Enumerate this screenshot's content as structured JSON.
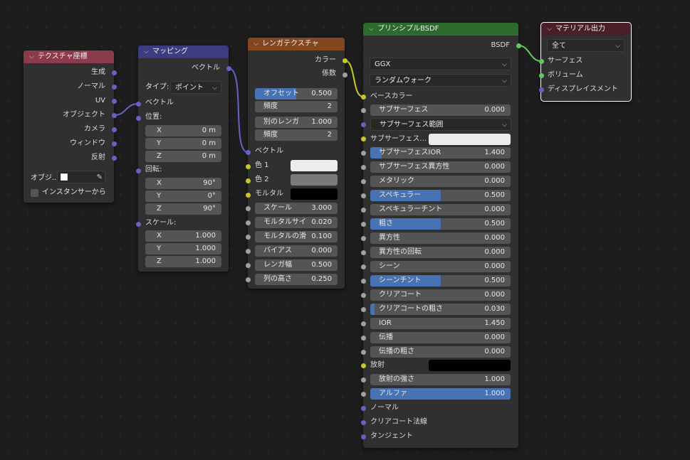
{
  "colors": {
    "header_texcoord": "#8c3a4e",
    "header_mapping": "#3c3c83",
    "header_brick": "#83461f",
    "header_principled": "#2c6b2e",
    "header_output": "#4a1f2a",
    "socket_vector": "#6363c7",
    "socket_color": "#c7c729",
    "socket_float": "#a1a1a1",
    "socket_shader": "#63c763",
    "slider_fill": "#4772b3"
  },
  "texcoord": {
    "title": "テクスチャ座標",
    "outputs": [
      "生成",
      "ノーマル",
      "UV",
      "オブジェクト",
      "カメラ",
      "ウィンドウ",
      "反射"
    ],
    "object_label": "オブジ...",
    "object_icon": "object-cube-icon",
    "eyedropper_icon": "eyedropper-icon",
    "instancer_label": "インスタンサーから",
    "instancer_checked": false
  },
  "mapping": {
    "title": "マッピング",
    "output_vector": "ベクトル",
    "type_label": "タイプ:",
    "type_value": "ポイント",
    "input_vector": "ベクトル",
    "location_label": "位置:",
    "location": [
      {
        "axis": "X",
        "value": "0 m"
      },
      {
        "axis": "Y",
        "value": "0 m"
      },
      {
        "axis": "Z",
        "value": "0 m"
      }
    ],
    "rotation_label": "回転:",
    "rotation": [
      {
        "axis": "X",
        "value": "90°"
      },
      {
        "axis": "Y",
        "value": "0°"
      },
      {
        "axis": "Z",
        "value": "90°"
      }
    ],
    "scale_label": "スケール:",
    "scale": [
      {
        "axis": "X",
        "value": "1.000"
      },
      {
        "axis": "Y",
        "value": "1.000"
      },
      {
        "axis": "Z",
        "value": "1.000"
      }
    ]
  },
  "brick": {
    "title": "レンガテクスチャ",
    "out_color": "カラー",
    "out_fac": "係数",
    "offset_label": "オフセット",
    "offset_value": "0.500",
    "offset_fill": 0.5,
    "freq1_label": "頻度",
    "freq1_value": "2",
    "squash_label": "別のレンガ",
    "squash_value": "1.000",
    "freq2_label": "頻度",
    "freq2_value": "2",
    "in_vector": "ベクトル",
    "color1_label": "色 1",
    "color1": "#ececec",
    "color2_label": "色 2",
    "color2": "#7a7a7a",
    "mortar_label": "モルタル",
    "mortar_color": "#000000",
    "params": [
      {
        "label": "スケール",
        "value": "3.000"
      },
      {
        "label": "モルタルサイ",
        "value": "0.020"
      },
      {
        "label": "モルタルの滑",
        "value": "0.100"
      },
      {
        "label": "バイアス",
        "value": "0.000"
      },
      {
        "label": "レンガ幅",
        "value": "0.500"
      },
      {
        "label": "列の高さ",
        "value": "0.250"
      }
    ]
  },
  "principled": {
    "title": "プリンシプルBSDF",
    "out_bsdf": "BSDF",
    "distribution": "GGX",
    "subsurface_method": "ランダムウォーク",
    "base_color_label": "ベースカラー",
    "subsurface_label": "サブサーフェス",
    "subsurface_value": "0.000",
    "subsurface_radius_label": "サブサーフェス範囲",
    "subsurface_color_label": "サブサーフェス...",
    "subsurface_color": "#ececec",
    "params": [
      {
        "label": "サブサーフェスIOR",
        "value": "1.400",
        "fill": 0.08
      },
      {
        "label": "サブサーフェス異方性",
        "value": "0.000",
        "fill": 0
      },
      {
        "label": "メタリック",
        "value": "0.000",
        "fill": 0
      },
      {
        "label": "スペキュラー",
        "value": "0.500",
        "fill": 0.5
      },
      {
        "label": "スペキュラーチント",
        "value": "0.000",
        "fill": 0
      },
      {
        "label": "粗さ",
        "value": "0.500",
        "fill": 0.5
      },
      {
        "label": "異方性",
        "value": "0.000",
        "fill": 0
      },
      {
        "label": "異方性の回転",
        "value": "0.000",
        "fill": 0
      },
      {
        "label": "シーン",
        "value": "0.000",
        "fill": 0
      },
      {
        "label": "シーンチント",
        "value": "0.500",
        "fill": 0.5
      },
      {
        "label": "クリアコート",
        "value": "0.000",
        "fill": 0
      },
      {
        "label": "クリアコートの粗さ",
        "value": "0.030",
        "fill": 0.03
      },
      {
        "label": "IOR",
        "value": "1.450",
        "fill": 0
      },
      {
        "label": "伝播",
        "value": "0.000",
        "fill": 0
      },
      {
        "label": "伝播の粗さ",
        "value": "0.000",
        "fill": 0
      }
    ],
    "emission_label": "放射",
    "emission_color": "#000000",
    "emission_strength_label": "放射の強さ",
    "emission_strength_value": "1.000",
    "alpha_label": "アルファ",
    "alpha_value": "1.000",
    "alpha_fill": 1.0,
    "normal_label": "ノーマル",
    "clearcoat_normal_label": "クリアコート法線",
    "tangent_label": "タンジェント"
  },
  "output": {
    "title": "マテリアル出力",
    "target": "全て",
    "surface_label": "サーフェス",
    "volume_label": "ボリューム",
    "displacement_label": "ディスプレイスメント"
  }
}
